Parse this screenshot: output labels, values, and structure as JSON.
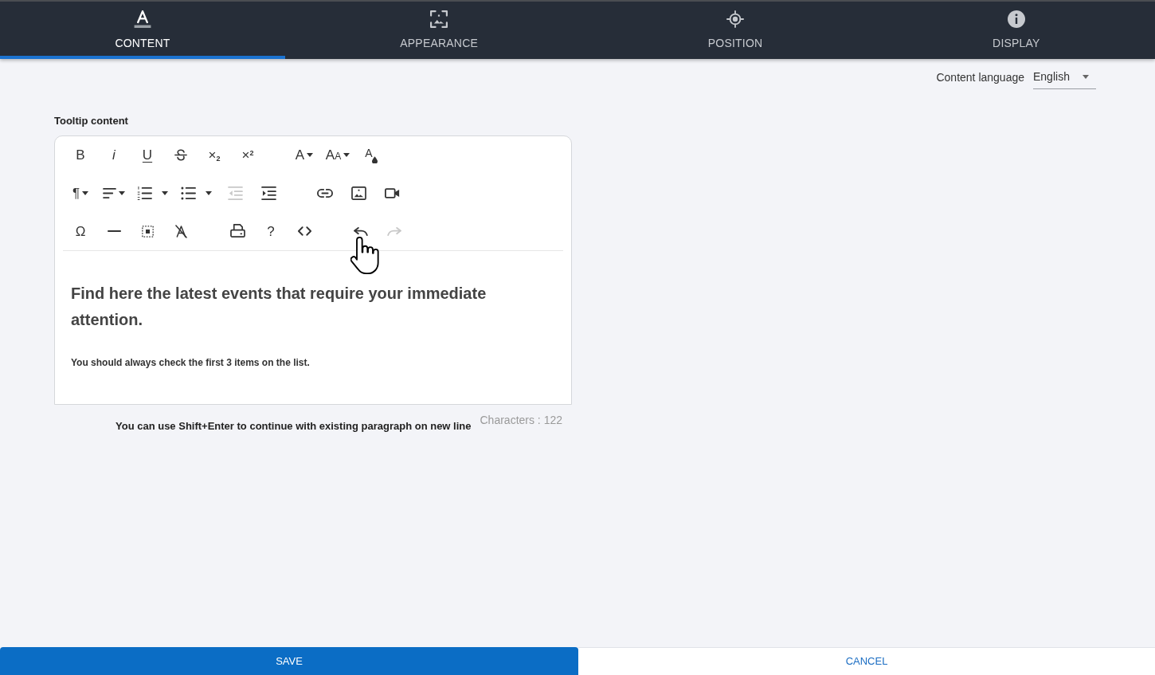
{
  "tabs": [
    {
      "label": "CONTENT",
      "selected": true
    },
    {
      "label": "APPEARANCE",
      "selected": false
    },
    {
      "label": "POSITION",
      "selected": false
    },
    {
      "label": "DISPLAY",
      "selected": false
    }
  ],
  "content_language": {
    "label": "Content language",
    "value": "English"
  },
  "editor": {
    "label": "Tooltip content",
    "toolbar": [
      {
        "groups": [
          [
            {
              "kind": "text",
              "glyph": "B",
              "dropdown": false,
              "disabled": false
            },
            {
              "kind": "text",
              "glyph": "i",
              "dropdown": false,
              "disabled": false
            },
            {
              "kind": "text",
              "glyph": "U",
              "dropdown": false,
              "disabled": false
            },
            {
              "kind": "icon",
              "dropdown": false,
              "disabled": false
            },
            {
              "kind": "text",
              "glyph": "×$_{2}$",
              "dropdown": false,
              "disabled": false
            },
            {
              "kind": "text",
              "glyph": "×$^{2}$",
              "dropdown": false,
              "disabled": false
            }
          ],
          [
            {
              "kind": "text",
              "glyph": "A",
              "dropdown": true,
              "disabled": false
            },
            {
              "kind": "text",
              "glyph": "AA",
              "dropdown": true,
              "disabled": false
            },
            {
              "kind": "text",
              "glyph": "A",
              "dropdown": false,
              "disabled": false
            }
          ]
        ]
      },
      {
        "groups": [
          [
            {
              "kind": "text",
              "glyph": "¶",
              "dropdown": true,
              "disabled": false
            },
            {
              "kind": "icon",
              "dropdown": true,
              "disabled": false
            },
            {
              "kind": "split",
              "dropdown": true,
              "disabled": false
            },
            {
              "kind": "split",
              "dropdown": true,
              "disabled": false
            },
            {
              "kind": "icon",
              "dropdown": false,
              "disabled": true
            },
            {
              "kind": "icon",
              "dropdown": false,
              "disabled": false
            }
          ],
          [
            {
              "kind": "icon",
              "dropdown": false,
              "disabled": false
            },
            {
              "kind": "icon",
              "dropdown": false,
              "disabled": false
            },
            {
              "kind": "icon",
              "dropdown": false,
              "disabled": false
            }
          ]
        ]
      },
      {
        "groups": [
          [
            {
              "kind": "text",
              "glyph": "Ω",
              "dropdown": false,
              "disabled": false
            },
            {
              "kind": "icon",
              "dropdown": false,
              "disabled": false
            },
            {
              "kind": "icon",
              "dropdown": false,
              "disabled": false
            },
            {
              "kind": "icon",
              "dropdown": false,
              "disabled": false
            }
          ],
          [
            {
              "kind": "icon",
              "dropdown": false,
              "disabled": false
            },
            {
              "kind": "text",
              "glyph": "?",
              "dropdown": false,
              "disabled": false
            },
            {
              "kind": "icon",
              "dropdown": false,
              "disabled": false
            }
          ],
          [
            {
              "kind": "icon",
              "dropdown": false,
              "disabled": false
            },
            {
              "kind": "icon",
              "dropdown": false,
              "disabled": true
            }
          ]
        ]
      }
    ],
    "heading": "Find here the latest events that require your immediate attention.",
    "paragraph": "You should always check the first 3 items on the list.",
    "hint": "You can use Shift+Enter to continue with existing paragraph on new line",
    "character_count": "Characters : 122"
  },
  "buttons": [
    {
      "label": "SAVE",
      "kind": "primary"
    },
    {
      "label": "CANCEL",
      "kind": "secondary"
    }
  ]
}
